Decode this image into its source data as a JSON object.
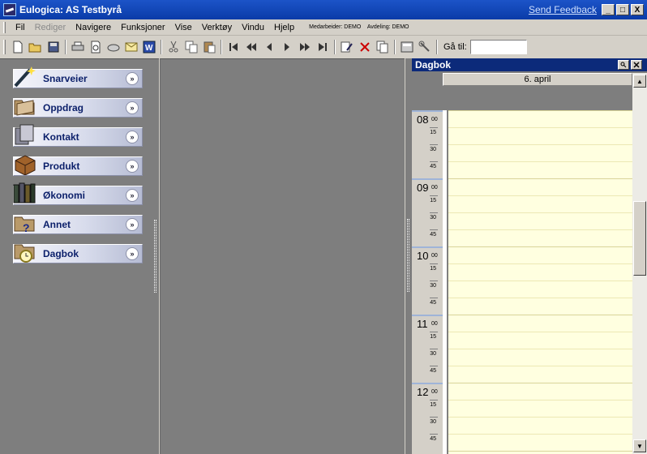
{
  "window": {
    "title": "Eulogica: AS Testbyrå",
    "feedback_link": "Send Feedback",
    "buttons": [
      "_",
      "□",
      "X"
    ]
  },
  "menu": {
    "items": [
      "Fil",
      "Rediger",
      "Navigere",
      "Funksjoner",
      "Vise",
      "Verktøy",
      "Vindu",
      "Hjelp"
    ],
    "disabled": [
      "Rediger"
    ],
    "user_info": {
      "employee": "Medarbeider: DEMO",
      "department": "Avdeling: DEMO"
    }
  },
  "toolbar": {
    "buttons": [
      "new",
      "open",
      "save",
      "print",
      "print-preview",
      "fax",
      "email",
      "word",
      "cut",
      "copy",
      "paste",
      "first",
      "rewind",
      "previous",
      "next",
      "fast-forward",
      "last",
      "edit",
      "delete",
      "copy-record",
      "calculator",
      "tools"
    ],
    "goto_label": "Gå til:",
    "goto_value": ""
  },
  "outlook_bar": {
    "items": [
      {
        "label": "Snarveier",
        "icon": "wand-icon"
      },
      {
        "label": "Oppdrag",
        "icon": "folder-icon"
      },
      {
        "label": "Kontakt",
        "icon": "contact-cards-icon"
      },
      {
        "label": "Produkt",
        "icon": "box-icon"
      },
      {
        "label": "Økonomi",
        "icon": "binders-icon"
      },
      {
        "label": "Annet",
        "icon": "question-folder-icon"
      },
      {
        "label": "Dagbok",
        "icon": "clock-folder-icon"
      }
    ]
  },
  "dagbok": {
    "title": "Dagbok",
    "date": "6. april",
    "hours": [
      {
        "hour": "08",
        "min": "00",
        "quarters": [
          "15",
          "30",
          "45"
        ]
      },
      {
        "hour": "09",
        "min": "00",
        "quarters": [
          "15",
          "30",
          "45"
        ]
      },
      {
        "hour": "10",
        "min": "00",
        "quarters": [
          "15",
          "30",
          "45"
        ]
      },
      {
        "hour": "11",
        "min": "00",
        "quarters": [
          "15",
          "30",
          "45"
        ]
      },
      {
        "hour": "12",
        "min": "00",
        "quarters": [
          "15",
          "30",
          "45"
        ]
      }
    ],
    "colors": {
      "slot_background": "#ffffe0",
      "header_background": "#0c2a7a"
    }
  }
}
